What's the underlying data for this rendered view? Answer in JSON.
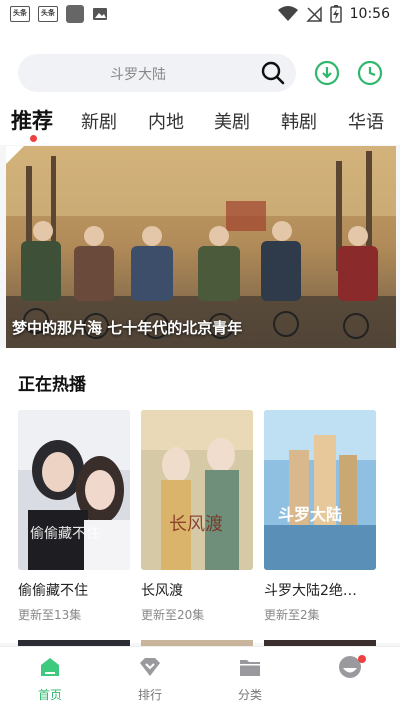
{
  "status_bar": {
    "app_badge_1": "头条",
    "app_badge_2": "头条",
    "time": "10:56",
    "icons": [
      "wifi-icon",
      "no-signal-icon",
      "battery-charging-icon"
    ]
  },
  "search": {
    "placeholder": "斗罗大陆"
  },
  "header_actions": [
    "download-icon",
    "history-icon"
  ],
  "tabs": [
    {
      "label": "推荐",
      "active": true
    },
    {
      "label": "新剧"
    },
    {
      "label": "内地"
    },
    {
      "label": "美剧"
    },
    {
      "label": "韩剧"
    },
    {
      "label": "华语"
    }
  ],
  "banner": {
    "caption": "梦中的那片海  七十年代的北京青年"
  },
  "section": {
    "title": "正在热播",
    "items": [
      {
        "title": "偷偷藏不住",
        "subtitle": "更新至13集"
      },
      {
        "title": "长风渡",
        "subtitle": "更新至20集"
      },
      {
        "title": "斗罗大陆2绝…",
        "subtitle": "更新至2集"
      }
    ]
  },
  "nav": [
    {
      "label": "首页",
      "icon": "home-icon",
      "active": true
    },
    {
      "label": "排行",
      "icon": "ranking-icon"
    },
    {
      "label": "分类",
      "icon": "category-folder-icon"
    },
    {
      "label": "",
      "icon": "profile-icon",
      "badge": true
    }
  ],
  "colors": {
    "accent": "#2fb86c",
    "badge": "#ef4040"
  }
}
